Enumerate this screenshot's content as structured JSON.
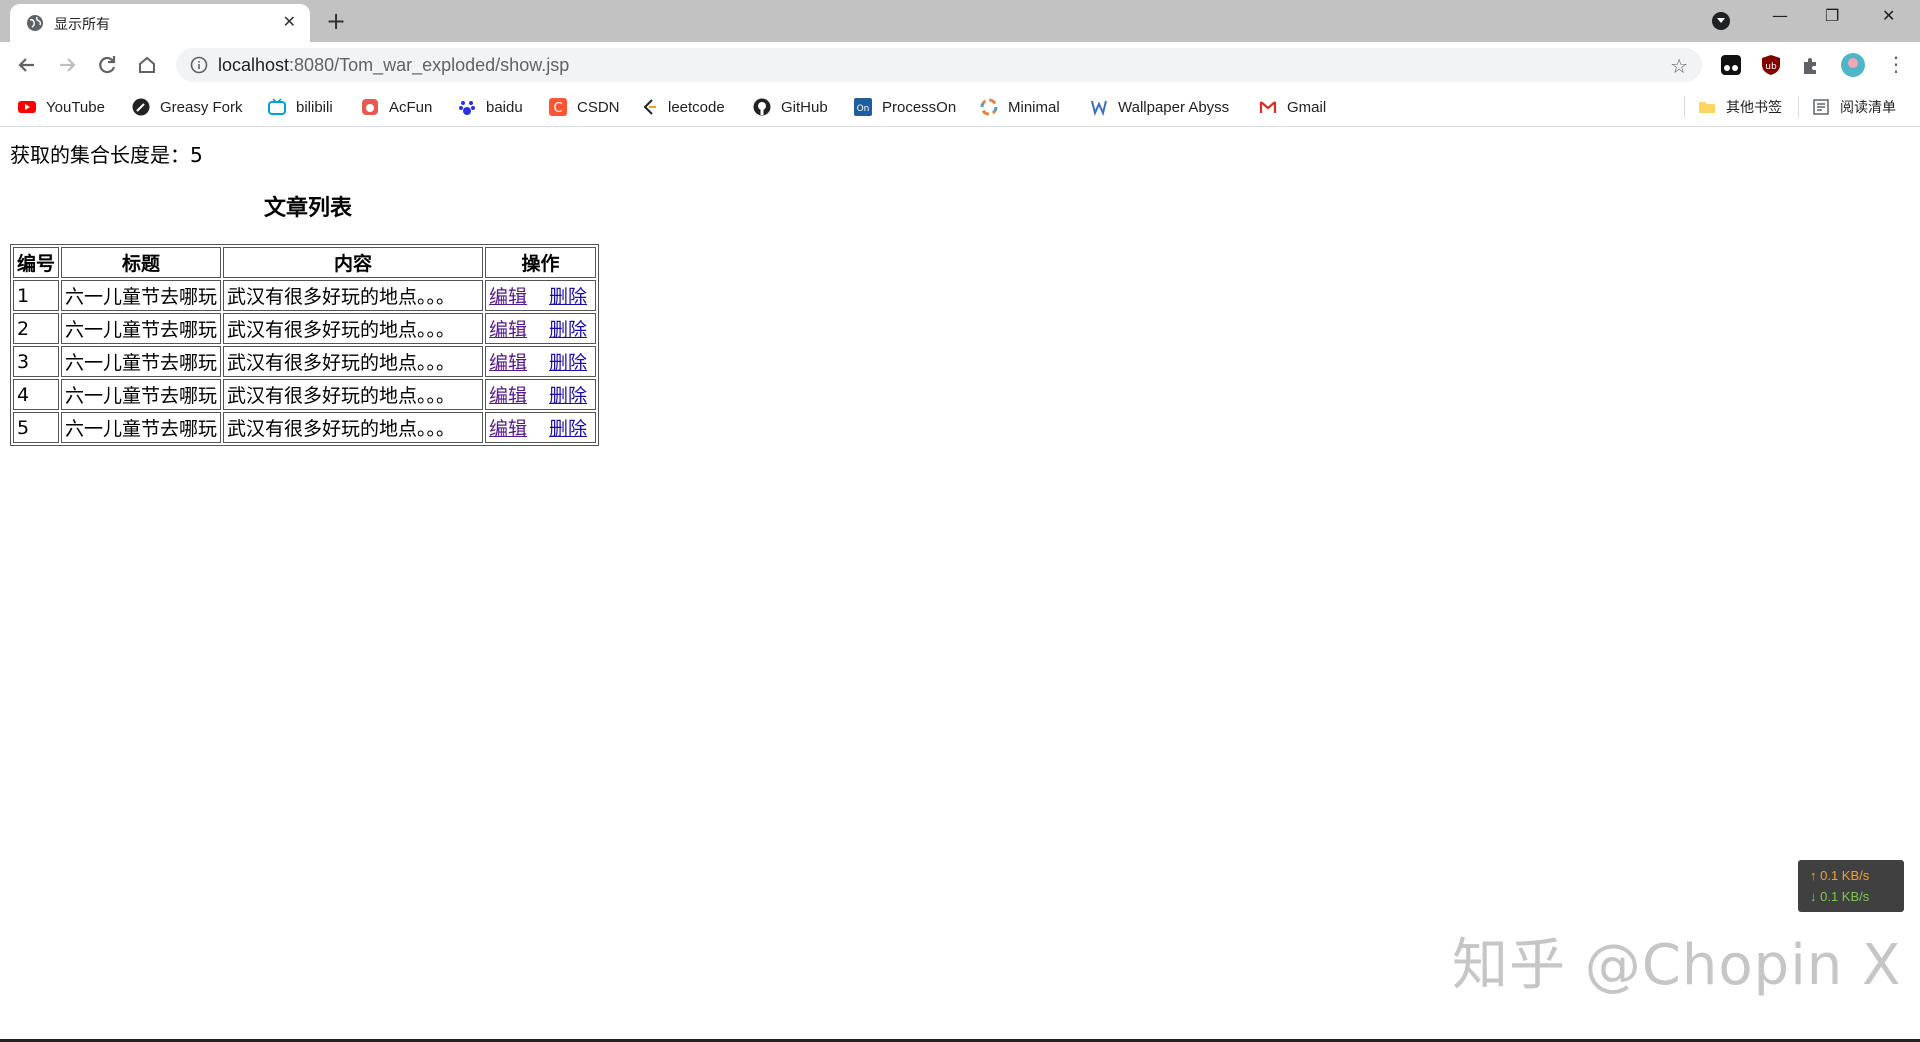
{
  "browser": {
    "tab": {
      "title": "显示所有",
      "close_symbol": "✕"
    },
    "new_tab_symbol": "+",
    "window_controls": {
      "minimize": "—",
      "restore": "❐",
      "close": "✕"
    },
    "url": {
      "host": "localhost",
      "rest": ":8080/Tom_war_exploded/show.jsp"
    },
    "star_symbol": "☆",
    "menu_symbol": "⋮"
  },
  "bookmarks": [
    {
      "label": "YouTube",
      "icon": "youtube-icon",
      "color": "#ff0000"
    },
    {
      "label": "Greasy Fork",
      "icon": "greasy-fork-icon",
      "color": "#222222"
    },
    {
      "label": "bilibili",
      "icon": "bilibili-icon",
      "color": "#00a1d6"
    },
    {
      "label": "AcFun",
      "icon": "acfun-icon",
      "color": "#e85a4f"
    },
    {
      "label": "baidu",
      "icon": "baidu-icon",
      "color": "#2932e1"
    },
    {
      "label": "CSDN",
      "icon": "csdn-icon",
      "color": "#fc5531"
    },
    {
      "label": "leetcode",
      "icon": "leetcode-icon",
      "color": "#222222"
    },
    {
      "label": "GitHub",
      "icon": "github-icon",
      "color": "#222222"
    },
    {
      "label": "ProcessOn",
      "icon": "processon-icon",
      "color": "#1f5e9e"
    },
    {
      "label": "Minimal",
      "icon": "minimal-icon",
      "color": "#e8833a"
    },
    {
      "label": "Wallpaper Abyss",
      "icon": "wallpaper-abyss-icon",
      "color": "#3b6fc4"
    },
    {
      "label": "Gmail",
      "icon": "gmail-icon",
      "color": "#d93025"
    }
  ],
  "bookmarks_right": {
    "other": "其他书签",
    "reading_list": "阅读清单"
  },
  "page": {
    "count_text": "获取的集合长度是：5",
    "caption": "文章列表",
    "table": {
      "headers": [
        "编号",
        "标题",
        "内容",
        "操作"
      ],
      "rows": [
        {
          "id": "1",
          "title": "六一儿童节去哪玩",
          "content": "武汉有很多好玩的地点。。。",
          "edit": "编辑",
          "delete": "删除"
        },
        {
          "id": "2",
          "title": "六一儿童节去哪玩",
          "content": "武汉有很多好玩的地点。。。",
          "edit": "编辑",
          "delete": "删除"
        },
        {
          "id": "3",
          "title": "六一儿童节去哪玩",
          "content": "武汉有很多好玩的地点。。。",
          "edit": "编辑",
          "delete": "删除"
        },
        {
          "id": "4",
          "title": "六一儿童节去哪玩",
          "content": "武汉有很多好玩的地点。。。",
          "edit": "编辑",
          "delete": "删除"
        },
        {
          "id": "5",
          "title": "六一儿童节去哪玩",
          "content": "武汉有很多好玩的地点。。。",
          "edit": "编辑",
          "delete": "删除"
        }
      ]
    }
  },
  "netspeed": {
    "up": "↑ 0.1 KB/s",
    "down": "↓ 0.1 KB/s"
  },
  "watermark": "知乎 @Chopin X"
}
